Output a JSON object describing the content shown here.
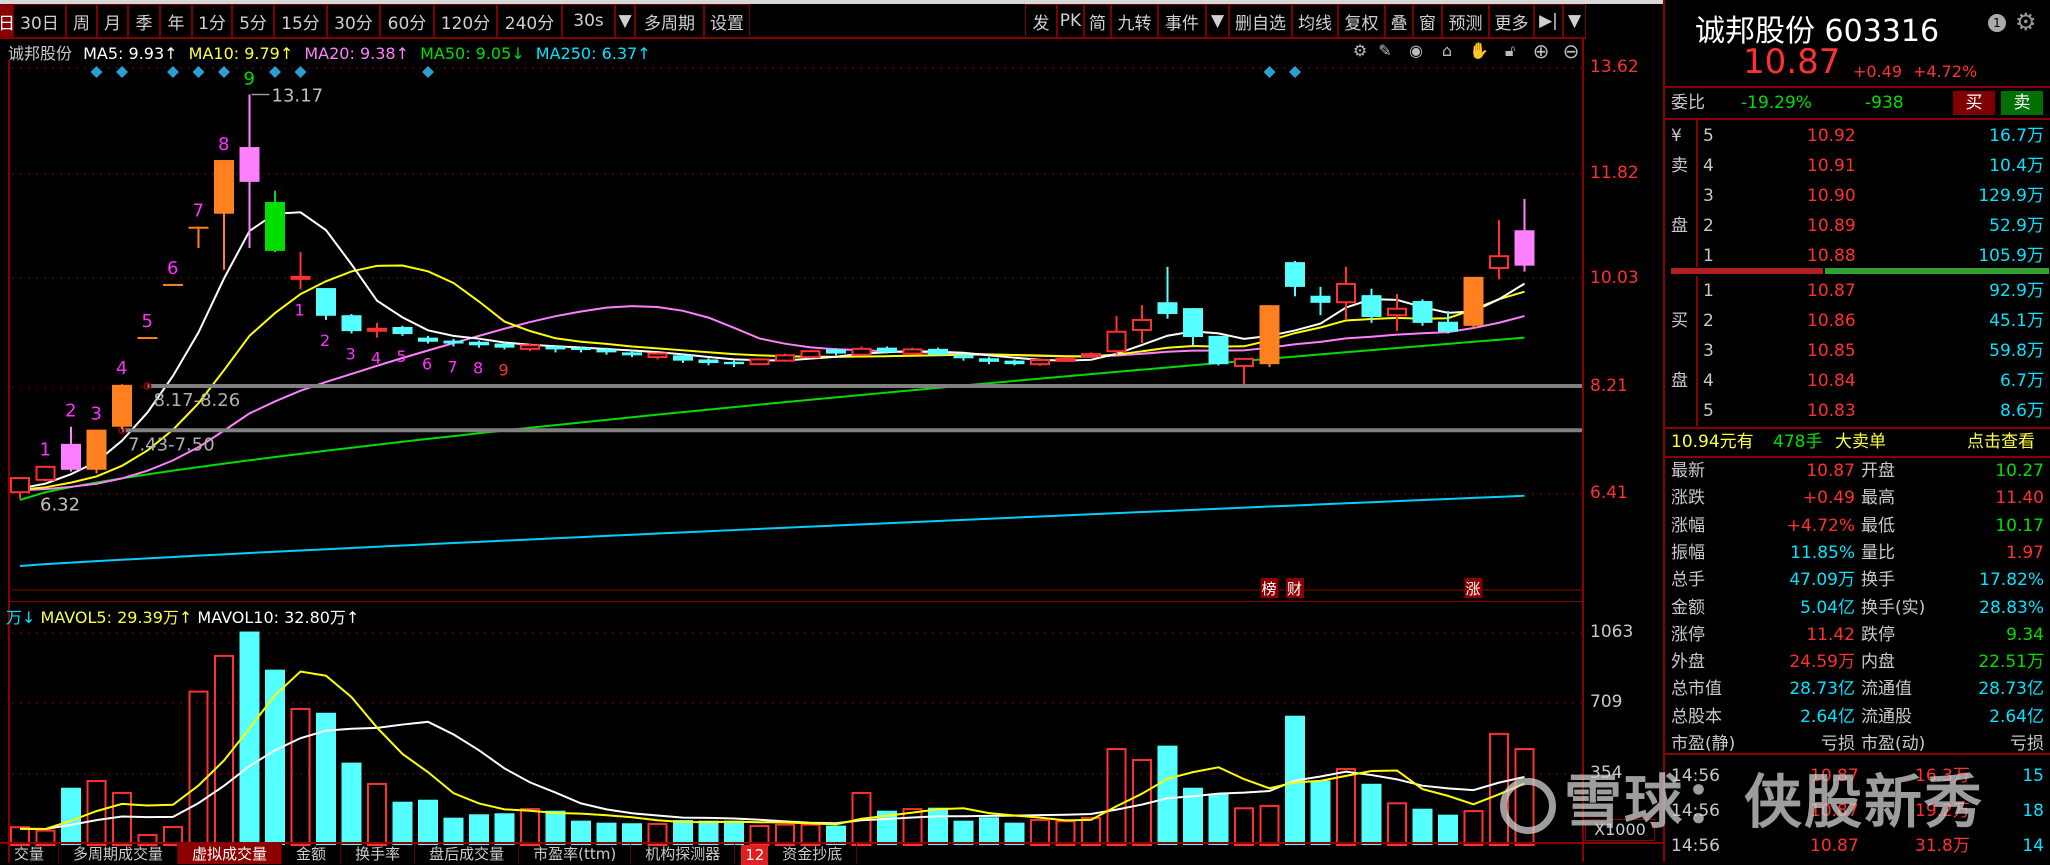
{
  "toolbar": {
    "left": [
      "日",
      "30日",
      "周",
      "月",
      "季",
      "年",
      "1分",
      "5分",
      "15分",
      "30分",
      "60分",
      "120分",
      "240分",
      "30s",
      "▼",
      "多周期",
      "设置"
    ],
    "right": [
      "发",
      "PK",
      "简",
      "九转",
      "事件",
      "▼",
      "删自选",
      "均线",
      "复权",
      "叠",
      "窗",
      "预测",
      "更多",
      "▶|",
      "▼"
    ]
  },
  "ma_row": {
    "name": "诚邦股份",
    "ma5": "MA5: 9.93↑",
    "ma10": "MA10: 9.79↑",
    "ma20": "MA20: 9.38↑",
    "ma50": "MA50: 9.05↓",
    "ma250": "MA250: 6.37↑"
  },
  "chart_tools": [
    "gear-icon",
    "pen-icon",
    "eye-icon",
    "trash-icon",
    "hand-icon",
    "lock-icon",
    "zoom-in-icon",
    "zoom-out-icon"
  ],
  "price_axis": [
    "13.62",
    "11.82",
    "10.03",
    "8.21",
    "6.41"
  ],
  "vol_axis": [
    "1063",
    "709",
    "354"
  ],
  "vol_unit": "X1000",
  "vol_header": {
    "prefix": "万↓",
    "mavol5": "MAVOL5: 29.39万↑",
    "mavol10": "MAVOL10: 32.80万↑"
  },
  "annotations": {
    "high": "13.17",
    "low": "6.32",
    "zone1": "8.17-8.26",
    "zone2": "7.43-7.50",
    "events": [
      "榜",
      "财",
      "涨"
    ]
  },
  "colors": {
    "up": "#ff3030",
    "down": "#55ffff",
    "orange": "#ff8020",
    "pink": "#ff80ff",
    "green": "#00dd00",
    "ma5": "#ffffff",
    "ma10": "#ffff00",
    "ma20": "#ff80ff",
    "ma50": "#00dd00",
    "ma250": "#00d0ff"
  },
  "chart_data": {
    "type": "candlestick",
    "ylim": [
      6.0,
      13.9
    ],
    "candles": [
      [
        6.43,
        6.67,
        6.32,
        6.67,
        "up"
      ],
      [
        6.64,
        6.88,
        6.62,
        6.86,
        "up"
      ],
      [
        6.81,
        7.54,
        6.78,
        7.25,
        "pink"
      ],
      [
        6.81,
        7.49,
        6.75,
        7.49,
        "orange"
      ],
      [
        7.54,
        8.26,
        7.5,
        8.25,
        "orange"
      ],
      [
        9.06,
        9.06,
        9.06,
        9.06,
        "orange"
      ],
      [
        9.96,
        9.96,
        9.96,
        9.96,
        "orange"
      ],
      [
        10.93,
        10.93,
        10.57,
        10.93,
        "orange"
      ],
      [
        11.15,
        12.06,
        10.2,
        12.06,
        "orange"
      ],
      [
        11.69,
        13.17,
        10.57,
        12.28,
        "pink"
      ],
      [
        11.35,
        11.54,
        10.5,
        10.52,
        "green"
      ],
      [
        10.08,
        10.5,
        9.87,
        10.08,
        "up"
      ],
      [
        9.89,
        9.89,
        9.35,
        9.42,
        "down"
      ],
      [
        9.43,
        9.45,
        9.12,
        9.16,
        "down"
      ],
      [
        9.2,
        9.3,
        9.05,
        9.2,
        "up"
      ],
      [
        9.23,
        9.25,
        9.08,
        9.11,
        "down"
      ],
      [
        9.05,
        9.08,
        8.95,
        8.98,
        "down"
      ],
      [
        9.0,
        9.03,
        8.9,
        8.95,
        "down"
      ],
      [
        8.98,
        9.0,
        8.88,
        8.92,
        "down"
      ],
      [
        8.95,
        8.97,
        8.85,
        8.88,
        "down"
      ],
      [
        8.86,
        8.95,
        8.82,
        8.92,
        "up"
      ],
      [
        8.9,
        8.92,
        8.8,
        8.85,
        "down"
      ],
      [
        8.88,
        8.9,
        8.8,
        8.84,
        "down"
      ],
      [
        8.85,
        8.88,
        8.76,
        8.8,
        "down"
      ],
      [
        8.8,
        8.84,
        8.72,
        8.75,
        "down"
      ],
      [
        8.72,
        8.8,
        8.68,
        8.78,
        "up"
      ],
      [
        8.75,
        8.77,
        8.62,
        8.66,
        "down"
      ],
      [
        8.68,
        8.7,
        8.58,
        8.62,
        "down"
      ],
      [
        8.64,
        8.66,
        8.55,
        8.6,
        "down"
      ],
      [
        8.6,
        8.7,
        8.58,
        8.68,
        "up"
      ],
      [
        8.66,
        8.78,
        8.64,
        8.75,
        "up"
      ],
      [
        8.72,
        8.84,
        8.7,
        8.82,
        "up"
      ],
      [
        8.85,
        8.87,
        8.75,
        8.78,
        "down"
      ],
      [
        8.76,
        8.9,
        8.74,
        8.86,
        "up"
      ],
      [
        8.88,
        8.9,
        8.78,
        8.8,
        "down"
      ],
      [
        8.78,
        8.88,
        8.76,
        8.85,
        "up"
      ],
      [
        8.86,
        8.88,
        8.74,
        8.76,
        "down"
      ],
      [
        8.76,
        8.78,
        8.66,
        8.7,
        "down"
      ],
      [
        8.7,
        8.72,
        8.6,
        8.64,
        "down"
      ],
      [
        8.66,
        8.68,
        8.58,
        8.6,
        "down"
      ],
      [
        8.6,
        8.7,
        8.57,
        8.67,
        "up"
      ],
      [
        8.68,
        8.72,
        8.64,
        8.69,
        "up"
      ],
      [
        8.74,
        8.8,
        8.72,
        8.77,
        "up"
      ],
      [
        8.82,
        9.42,
        8.76,
        9.15,
        "up"
      ],
      [
        9.18,
        9.6,
        8.96,
        9.35,
        "up"
      ],
      [
        9.65,
        10.25,
        9.37,
        9.45,
        "down"
      ],
      [
        9.55,
        9.55,
        8.91,
        9.06,
        "down"
      ],
      [
        9.08,
        9.08,
        8.58,
        8.6,
        "down"
      ],
      [
        8.57,
        8.69,
        8.25,
        8.69,
        "up"
      ],
      [
        8.6,
        9.6,
        8.55,
        9.6,
        "orange"
      ],
      [
        10.33,
        10.35,
        9.75,
        9.91,
        "down"
      ],
      [
        9.76,
        9.91,
        9.43,
        9.64,
        "down"
      ],
      [
        9.65,
        10.25,
        9.35,
        9.96,
        "up"
      ],
      [
        9.77,
        9.88,
        9.3,
        9.4,
        "down"
      ],
      [
        9.43,
        9.79,
        9.16,
        9.54,
        "up"
      ],
      [
        9.67,
        9.7,
        9.25,
        9.3,
        "down"
      ],
      [
        9.32,
        9.5,
        9.12,
        9.15,
        "down"
      ],
      [
        9.25,
        10.08,
        9.2,
        10.08,
        "orange"
      ],
      [
        10.23,
        11.04,
        10.04,
        10.43,
        "up"
      ],
      [
        10.27,
        11.4,
        10.17,
        10.87,
        "pink"
      ]
    ],
    "volume": [
      [
        89,
        "up"
      ],
      [
        72,
        "up"
      ],
      [
        287,
        "down"
      ],
      [
        321,
        "up"
      ],
      [
        261,
        "up"
      ],
      [
        50,
        "up"
      ],
      [
        90,
        "up"
      ],
      [
        769,
        "up"
      ],
      [
        948,
        "up"
      ],
      [
        1070,
        "down"
      ],
      [
        879,
        "down"
      ],
      [
        682,
        "up"
      ],
      [
        663,
        "down"
      ],
      [
        413,
        "down"
      ],
      [
        306,
        "up"
      ],
      [
        217,
        "down"
      ],
      [
        227,
        "down"
      ],
      [
        137,
        "down"
      ],
      [
        154,
        "down"
      ],
      [
        159,
        "down"
      ],
      [
        180,
        "up"
      ],
      [
        172,
        "down"
      ],
      [
        122,
        "down"
      ],
      [
        112,
        "down"
      ],
      [
        109,
        "down"
      ],
      [
        105,
        "up"
      ],
      [
        125,
        "down"
      ],
      [
        122,
        "down"
      ],
      [
        122,
        "down"
      ],
      [
        95,
        "up"
      ],
      [
        102,
        "up"
      ],
      [
        102,
        "up"
      ],
      [
        97,
        "down"
      ],
      [
        261,
        "up"
      ],
      [
        172,
        "down"
      ],
      [
        180,
        "up"
      ],
      [
        187,
        "down"
      ],
      [
        122,
        "down"
      ],
      [
        139,
        "down"
      ],
      [
        112,
        "down"
      ],
      [
        125,
        "up"
      ],
      [
        119,
        "up"
      ],
      [
        135,
        "up"
      ],
      [
        481,
        "up"
      ],
      [
        426,
        "up"
      ],
      [
        498,
        "down"
      ],
      [
        287,
        "down"
      ],
      [
        256,
        "down"
      ],
      [
        184,
        "up"
      ],
      [
        196,
        "up"
      ],
      [
        648,
        "down"
      ],
      [
        323,
        "down"
      ],
      [
        381,
        "up"
      ],
      [
        307,
        "down"
      ],
      [
        209,
        "up"
      ],
      [
        182,
        "down"
      ],
      [
        152,
        "down"
      ],
      [
        170,
        "up"
      ],
      [
        557,
        "up"
      ],
      [
        481,
        "up"
      ]
    ],
    "ma50": {
      "start": 6.3,
      "end": 9.05
    },
    "ma250": {
      "start": 5.18,
      "end": 6.37
    },
    "support_zones": [
      {
        "label_key": "zone1",
        "value": 8.23,
        "from_index": 5
      },
      {
        "label_key": "zone2",
        "value": 7.48,
        "from_index": 4
      }
    ],
    "diamond_indices": [
      3,
      4,
      6,
      7,
      8,
      10,
      11,
      16,
      49,
      50
    ],
    "td_up": [
      [
        1,
        "1"
      ],
      [
        2,
        "2"
      ],
      [
        3,
        "3"
      ],
      [
        4,
        "4"
      ],
      [
        5,
        "5"
      ],
      [
        6,
        "6"
      ],
      [
        7,
        "7"
      ],
      [
        8,
        "8"
      ],
      [
        9,
        "9"
      ]
    ],
    "td_down": [
      [
        11,
        "1"
      ],
      [
        12,
        "2"
      ],
      [
        13,
        "3"
      ],
      [
        14,
        "4"
      ],
      [
        15,
        "5"
      ],
      [
        16,
        "6"
      ],
      [
        17,
        "7"
      ],
      [
        18,
        "8"
      ],
      [
        19,
        "9"
      ]
    ],
    "event_indices": [
      49,
      50,
      57
    ]
  },
  "quote": {
    "title": "诚邦股份 603316",
    "badge": "1",
    "price": "10.87",
    "change": "+0.49",
    "pct": "+4.72%",
    "weibi_label": "委比",
    "weibi_pct": "-19.29%",
    "weibi_diff": "-938",
    "buy_btn": "买",
    "sell_btn": "卖",
    "sell_side_label": [
      "¥",
      "卖",
      "",
      "盘",
      ""
    ],
    "buy_side_label": [
      "",
      "买",
      "",
      "盘",
      ""
    ],
    "asks": [
      [
        "5",
        "10.92",
        "16.7万"
      ],
      [
        "4",
        "10.91",
        "10.4万"
      ],
      [
        "3",
        "10.90",
        "129.9万"
      ],
      [
        "2",
        "10.89",
        "52.9万"
      ],
      [
        "1",
        "10.88",
        "105.9万"
      ]
    ],
    "bids": [
      [
        "1",
        "10.87",
        "92.9万"
      ],
      [
        "2",
        "10.86",
        "45.1万"
      ],
      [
        "3",
        "10.85",
        "59.8万"
      ],
      [
        "4",
        "10.84",
        "6.7万"
      ],
      [
        "5",
        "10.83",
        "8.6万"
      ]
    ],
    "bigorder": {
      "price": "10.94元有",
      "qty": "478手",
      "label": "大卖单",
      "link": "点击查看"
    },
    "stats": [
      [
        "最新",
        "10.87",
        "red",
        "开盘",
        "10.27",
        "green"
      ],
      [
        "涨跌",
        "+0.49",
        "red",
        "最高",
        "11.40",
        "red"
      ],
      [
        "涨幅",
        "+4.72%",
        "red",
        "最低",
        "10.17",
        "green"
      ],
      [
        "振幅",
        "11.85%",
        "cyan",
        "量比",
        "1.97",
        "red"
      ],
      [
        "总手",
        "47.09万",
        "cyan",
        "换手",
        "17.82%",
        "cyan"
      ],
      [
        "金额",
        "5.04亿",
        "cyan",
        "换手(实)",
        "28.83%",
        "cyan"
      ],
      [
        "涨停",
        "11.42",
        "red",
        "跌停",
        "9.34",
        "green"
      ],
      [
        "外盘",
        "24.59万",
        "red",
        "内盘",
        "22.51万",
        "green"
      ],
      [
        "总市值",
        "28.73亿",
        "cyan",
        "流通值",
        "28.73亿",
        "cyan"
      ],
      [
        "总股本",
        "2.64亿",
        "cyan",
        "流通股",
        "2.64亿",
        "cyan"
      ],
      [
        "市盈(静)",
        "亏损",
        "gray",
        "市盈(动)",
        "亏损",
        "gray"
      ]
    ],
    "ticks": [
      [
        "14:56",
        "10.87",
        "16.3万",
        "15"
      ],
      [
        "14:56",
        "10.87",
        "19.2万",
        "18"
      ],
      [
        "14:56",
        "10.87",
        "31.8万",
        "14"
      ]
    ]
  },
  "bottom_tabs": [
    "交量",
    "多周期成交量",
    "虚拟成交量",
    "金额",
    "换手率",
    "盘后成交量",
    "市盈率(ttm)",
    "机构探测器",
    "12",
    "资金抄底"
  ],
  "watermark": "雪球：侠股新秀"
}
